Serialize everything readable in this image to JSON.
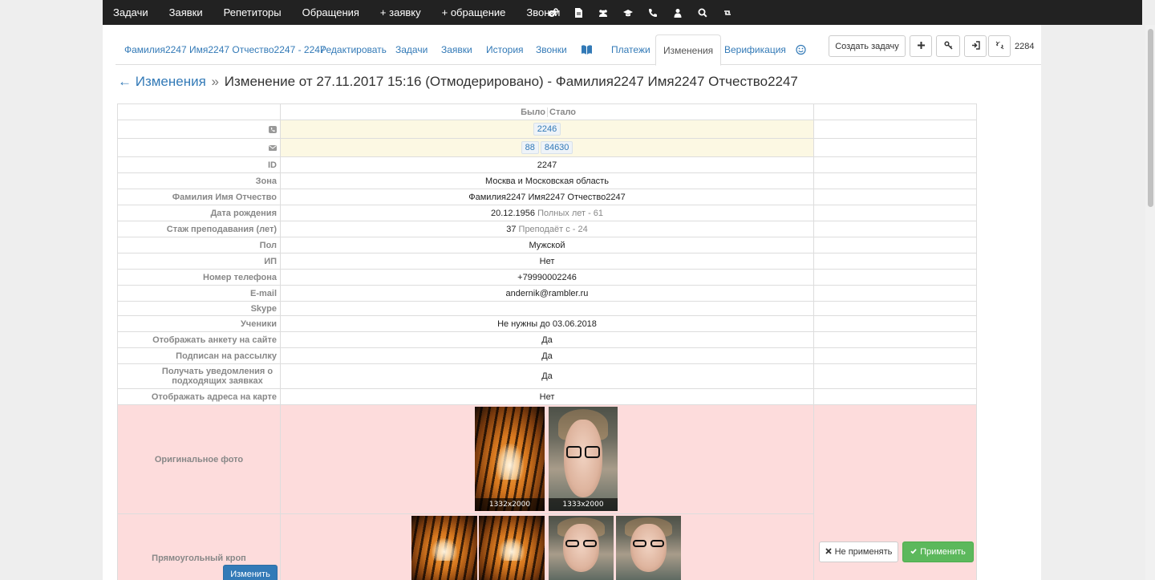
{
  "nav": {
    "items": [
      "Задачи",
      "Заявки",
      "Репетиторы",
      "Обращения",
      "+ заявку",
      "+ обращение",
      "Звонки"
    ],
    "icons": [
      "gears-icon",
      "file-icon",
      "users-icon",
      "graduation-cap-icon",
      "phone-icon",
      "user-icon",
      "search-icon",
      "retweet-icon"
    ]
  },
  "tabs": {
    "person": "Фамилия2247 Имя2247 Отчество2247 - 2247",
    "edit": "Редактировать",
    "tasks": "Задачи",
    "requests": "Заявки",
    "history": "История",
    "calls": "Звонки",
    "payments": "Платежи",
    "changes": "Изменения",
    "verification": "Верификация"
  },
  "toolbar": {
    "create_task": "Создать задачу",
    "counter": "2284"
  },
  "heading": {
    "back": "← Изменения",
    "separator": "»",
    "title": "Изменение от 27.11.2017 15:16 (Отмодерировано) - Фамилия2247 Имя2247 Отчество2247"
  },
  "table": {
    "col_before": "Было",
    "col_after": "Стало",
    "phones": [
      "2246"
    ],
    "emails": [
      "88",
      "84630"
    ],
    "rows": [
      {
        "label": "ID",
        "value": "2247",
        "note": ""
      },
      {
        "label": "Зона",
        "value": "Москва и Московская область",
        "note": ""
      },
      {
        "label": "Фамилия Имя Отчество",
        "value": "Фамилия2247 Имя2247 Отчество2247",
        "note": ""
      },
      {
        "label": "Дата рождения",
        "value": "20.12.1956",
        "note": "Полных лет - 61"
      },
      {
        "label": "Стаж преподавания (лет)",
        "value": "37",
        "note": "Преподаёт с - 24"
      },
      {
        "label": "Пол",
        "value": "Мужской",
        "note": ""
      },
      {
        "label": "ИП",
        "value": "Нет",
        "note": ""
      },
      {
        "label": "Номер телефона",
        "value": "+79990002246",
        "note": ""
      },
      {
        "label": "E-mail",
        "value": "andernik@rambler.ru",
        "note": ""
      },
      {
        "label": "Skype",
        "value": "",
        "note": ""
      },
      {
        "label": "Ученики",
        "value": "Не нужны до 03.06.2018",
        "note": ""
      },
      {
        "label": "Отображать анкету на сайте",
        "value": "Да",
        "note": ""
      },
      {
        "label": "Подписан на рассылку",
        "value": "Да",
        "note": ""
      },
      {
        "label": "Получать уведомления о подходящих заявках",
        "value": "Да",
        "note": ""
      },
      {
        "label": "Отображать адреса на карте",
        "value": "Нет",
        "note": ""
      }
    ],
    "original_photo_label": "Оригинальное фото",
    "original_photo_before_size": "1332x2000",
    "original_photo_after_size": "1333x2000",
    "crop_label": "Прямоугольный кроп",
    "edit_button": "Изменить",
    "no_apply_button": "Не применять",
    "apply_button": "Применить"
  }
}
